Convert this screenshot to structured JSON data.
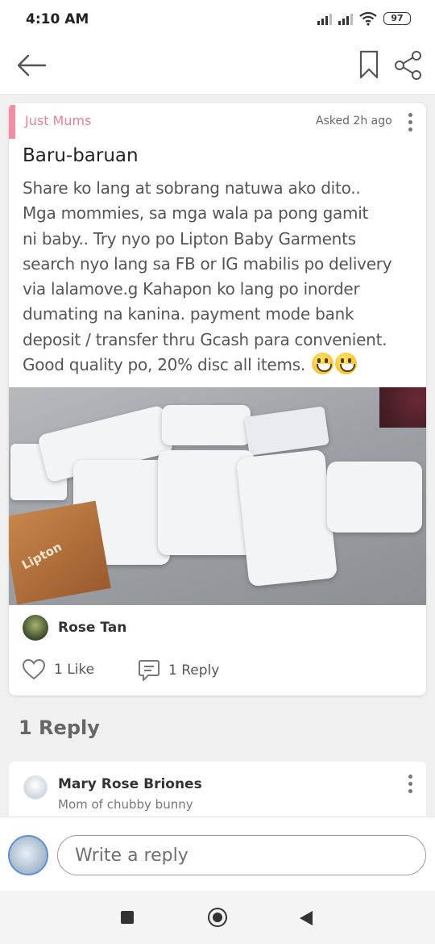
{
  "status_bar": {
    "time": "4:10 AM",
    "battery": "97",
    "icons": [
      "signal-icon",
      "signal-icon",
      "wifi-icon",
      "battery-icon"
    ]
  },
  "app_bar": {
    "icons": [
      "back-arrow-icon",
      "bookmark-icon",
      "share-icon"
    ]
  },
  "post": {
    "community": "Just Mums",
    "asked": "Asked 2h ago",
    "title": "Baru-baruan",
    "body": "Share ko lang at sobrang natuwa ako dito..\nMga mommies, sa mga wala pa pong gamit\nni baby.. Try nyo po Lipton Baby Garments\nsearch nyo lang sa FB or IG mabilis po delivery\nvia lalamove.g Kahapon ko lang po inorder\ndumating na kanina. payment mode bank\ndeposit / transfer thru Gcash para convenient.\nGood quality po, 20% disc all items. ",
    "emoji": [
      "grinning-face-emoji",
      "grinning-face-emoji"
    ],
    "photo_brand_text": "Lipton",
    "author": "Rose Tan",
    "like_label": "1 Like",
    "reply_label": "1 Reply"
  },
  "replies": {
    "heading": "1 Reply",
    "items": [
      {
        "author": "Mary Rose Briones",
        "subtitle": "Mom of chubby bunny"
      }
    ]
  },
  "composer": {
    "placeholder": "Write a reply"
  },
  "colors": {
    "accent_pink": "#f58ba5",
    "community_text": "#ee7d97",
    "avatar_ring": "#5b8fd6"
  }
}
